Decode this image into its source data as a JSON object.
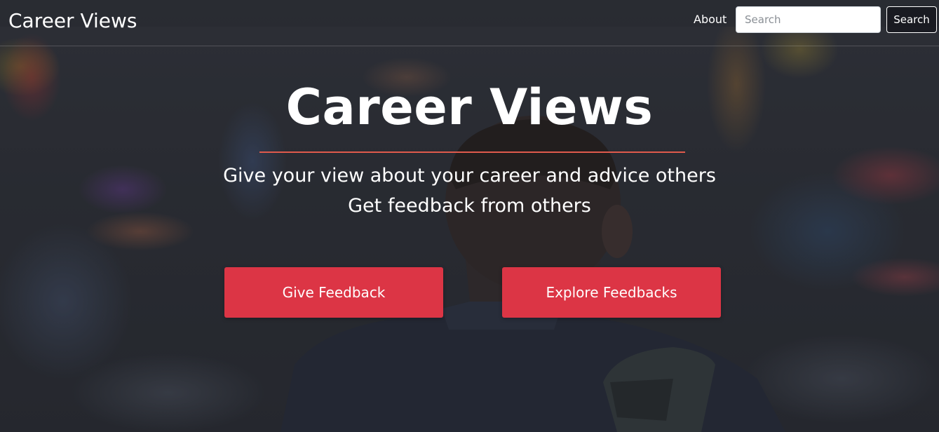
{
  "navbar": {
    "brand": "Career Views",
    "about_link": "About",
    "search_placeholder": "Search",
    "search_button": "Search"
  },
  "hero": {
    "title": "Career Views",
    "subtitle_line1": "Give your view about your career and advice others",
    "subtitle_line2": "Get feedback from others",
    "give_feedback_button": "Give Feedback",
    "explore_feedbacks_button": "Explore Feedbacks"
  },
  "colors": {
    "accent_red": "#dc3545",
    "rule": "#e05a4c",
    "text": "#ffffff"
  }
}
